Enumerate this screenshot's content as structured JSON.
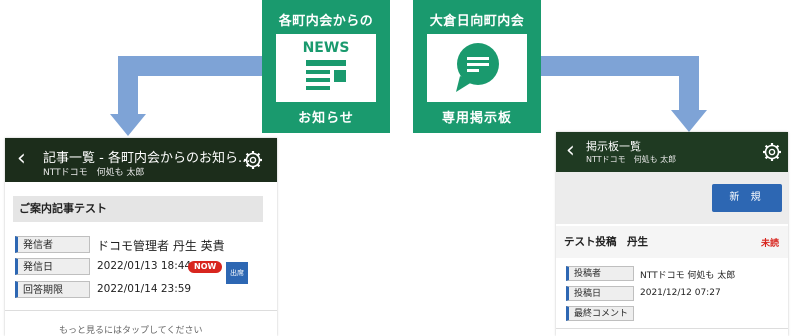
{
  "tiles": {
    "news": {
      "title": "各町内会からの",
      "inner": "NEWS",
      "bottom": "お知らせ"
    },
    "board": {
      "title": "大倉日向町内会",
      "bottom": "専用掲示板"
    }
  },
  "left_phone": {
    "header_title": "記事一覧 - 各町内会からのお知ら...",
    "header_sub": "NTTドコモ　何処も 太郎",
    "card_title": "ご案内記事テスト",
    "rows": [
      {
        "label": "発信者",
        "value": "ドコモ管理者 丹生 英貴"
      },
      {
        "label": "発信日",
        "value": "2022/01/13 18:44"
      },
      {
        "label": "回答期限",
        "value": "2022/01/14 23:59"
      }
    ],
    "now_badge": "NOW",
    "side_button": "出席",
    "more_hint": "もっと見るにはタップしてください"
  },
  "right_phone": {
    "header_title": "掲示板一覧",
    "header_sub": "NTTドコモ　何処も 太郎",
    "new_button": "新 規",
    "post_title": "テスト投稿　丹生",
    "unread": "未読",
    "rows": [
      {
        "label": "投稿者",
        "value": "NTTドコモ 何処も 太郎"
      },
      {
        "label": "投稿日",
        "value": "2021/12/12 07:27"
      },
      {
        "label": "最終コメント",
        "value": ""
      }
    ]
  },
  "colors": {
    "green": "#1a9a6e",
    "header": "#1c2d1b",
    "blue": "#2d67b3",
    "arrow": "#7ea3d6",
    "red": "#d8261f"
  }
}
